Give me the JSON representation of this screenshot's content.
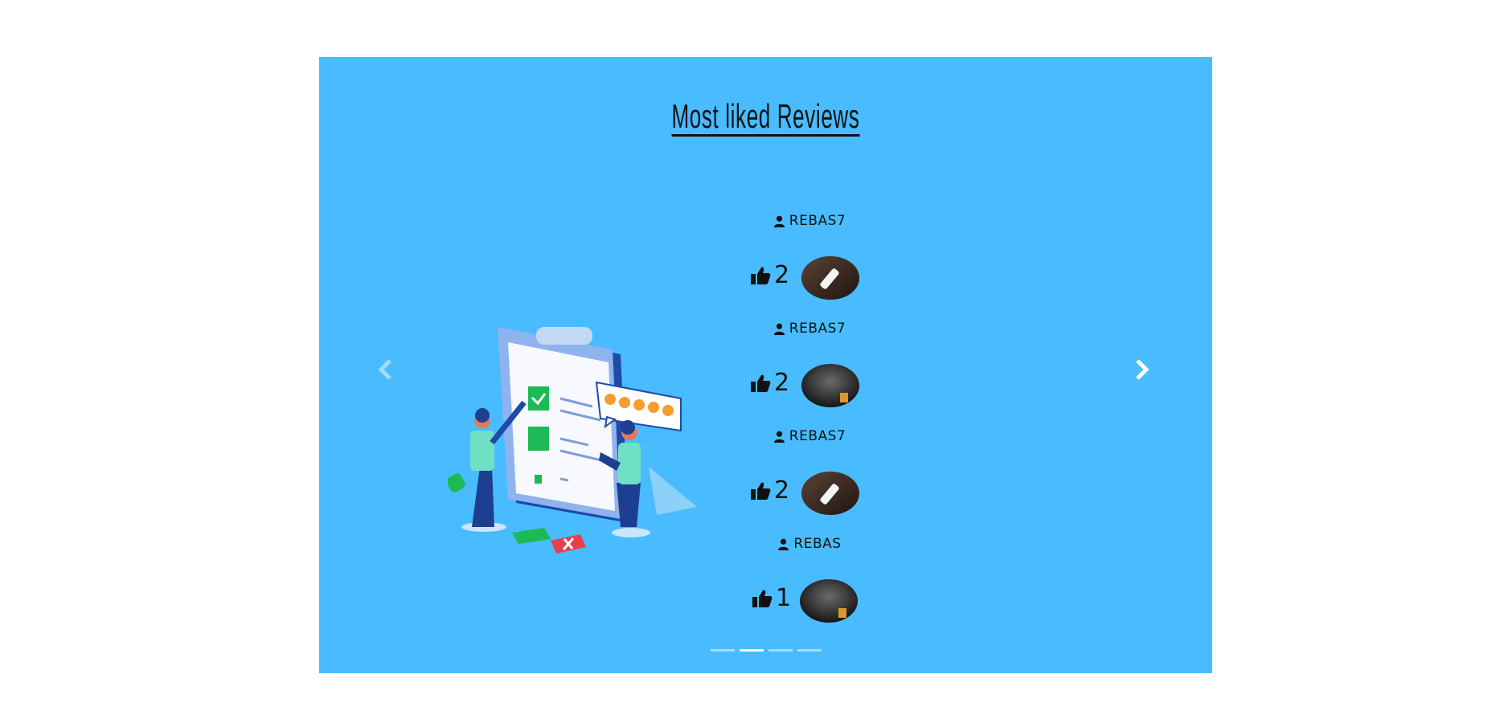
{
  "section": {
    "title": "Most liked Reviews"
  },
  "reviews": [
    {
      "username": "REBAS7",
      "likes": "2",
      "image": "light-stick-on-wood"
    },
    {
      "username": "REBAS7",
      "likes": "2",
      "image": "dark-drink-glass"
    },
    {
      "username": "REBAS7",
      "likes": "2",
      "image": "light-stick-on-wood"
    },
    {
      "username": "REBAS",
      "likes": "1",
      "image": "dark-drink-glass"
    }
  ],
  "carousel": {
    "slides": 4,
    "active_index": 1
  },
  "colors": {
    "panel_bg": "#48bcfe",
    "text": "#111111",
    "indicator_active": "#ffffff"
  }
}
